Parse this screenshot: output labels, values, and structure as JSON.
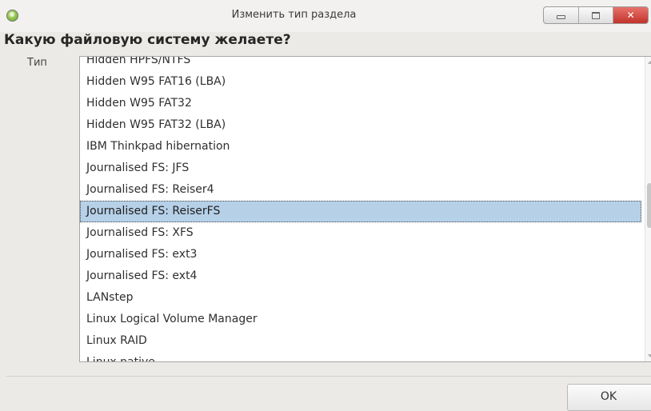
{
  "window": {
    "title": "Изменить тип раздела"
  },
  "dialog": {
    "heading": "Какую файловую систему желаете?",
    "type_label": "Тип",
    "ok_label": "OK"
  },
  "list": {
    "items": [
      "Hidden HPFS/NTFS",
      "Hidden W95 FAT16 (LBA)",
      "Hidden W95 FAT32",
      "Hidden W95 FAT32 (LBA)",
      "IBM Thinkpad hibernation",
      "Journalised FS: JFS",
      "Journalised FS: Reiser4",
      "Journalised FS: ReiserFS",
      "Journalised FS: XFS",
      "Journalised FS: ext3",
      "Journalised FS: ext4",
      "LANstep",
      "Linux Logical Volume Manager",
      "Linux RAID",
      "Linux native"
    ],
    "selected": "Journalised FS: ReiserFS"
  }
}
